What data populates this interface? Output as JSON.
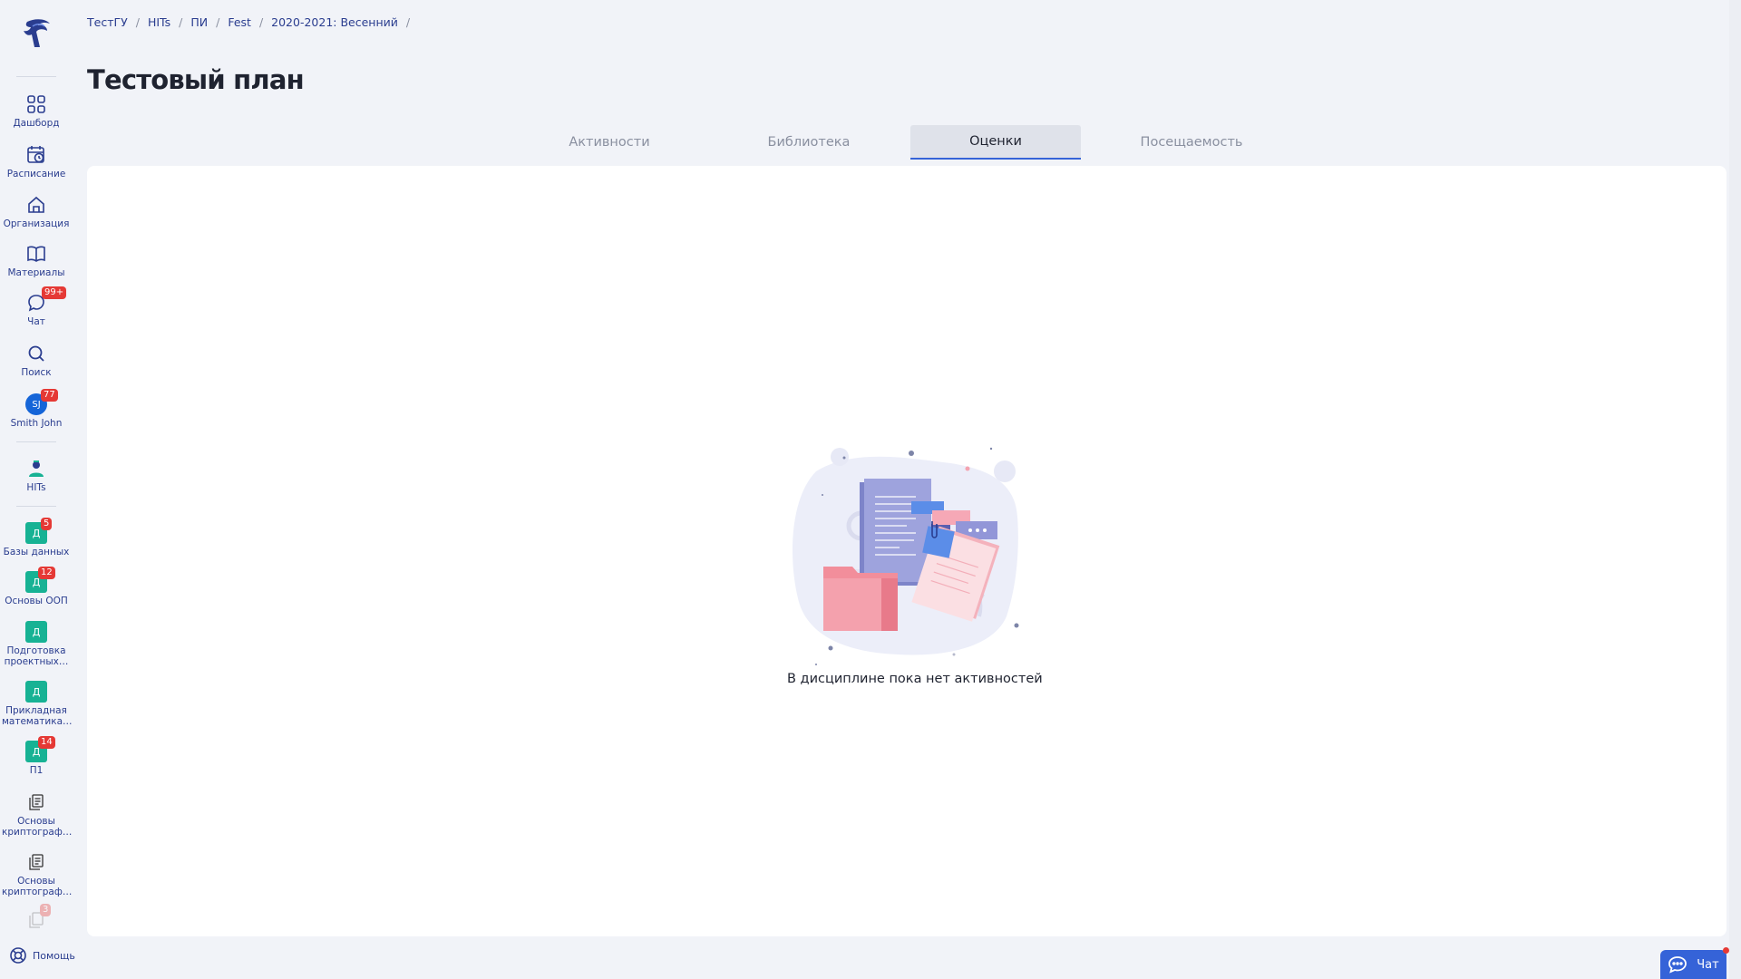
{
  "sidebar": {
    "nav": [
      {
        "label": "Дашборд",
        "icon": "dashboard-icon"
      },
      {
        "label": "Расписание",
        "icon": "schedule-icon"
      },
      {
        "label": "Организация",
        "icon": "organization-icon"
      },
      {
        "label": "Материалы",
        "icon": "materials-icon"
      },
      {
        "label": "Чат",
        "icon": "chat-icon",
        "badge": "99+"
      },
      {
        "label": "Поиск",
        "icon": "search-icon"
      }
    ],
    "profile": {
      "initials": "SJ",
      "label": "Smith John",
      "badge": "77"
    },
    "org": {
      "label": "HITs"
    },
    "courses": [
      {
        "letter": "Д",
        "label": "Базы данных",
        "badge": "5"
      },
      {
        "letter": "Д",
        "label": "Основы ООП",
        "badge": "12"
      },
      {
        "letter": "Д",
        "label": "Подготовка проектных…",
        "badge": ""
      },
      {
        "letter": "Д",
        "label": "Прикладная математика…",
        "badge": ""
      },
      {
        "letter": "Д",
        "label": "П1",
        "badge": "14"
      }
    ],
    "docs": [
      {
        "label": "Основы криптограф…"
      },
      {
        "label": "Основы криптограф…"
      }
    ],
    "faded_badge": "3",
    "help": "Помощь"
  },
  "breadcrumb": [
    "ТестГУ",
    "HITs",
    "ПИ",
    "Fest",
    "2020-2021: Весенний"
  ],
  "page_title": "Тестовый план",
  "tabs": [
    {
      "label": "Активности",
      "active": false
    },
    {
      "label": "Библиотека",
      "active": false
    },
    {
      "label": "Оценки",
      "active": true
    },
    {
      "label": "Посещаемость",
      "active": false
    }
  ],
  "empty_state": {
    "text": "В дисциплине пока нет активностей"
  },
  "chat_button": {
    "label": "Чат"
  },
  "colors": {
    "accent": "#3563d8",
    "nav_text": "#2a3d8f",
    "course": "#17b294",
    "badge": "#e53935"
  }
}
